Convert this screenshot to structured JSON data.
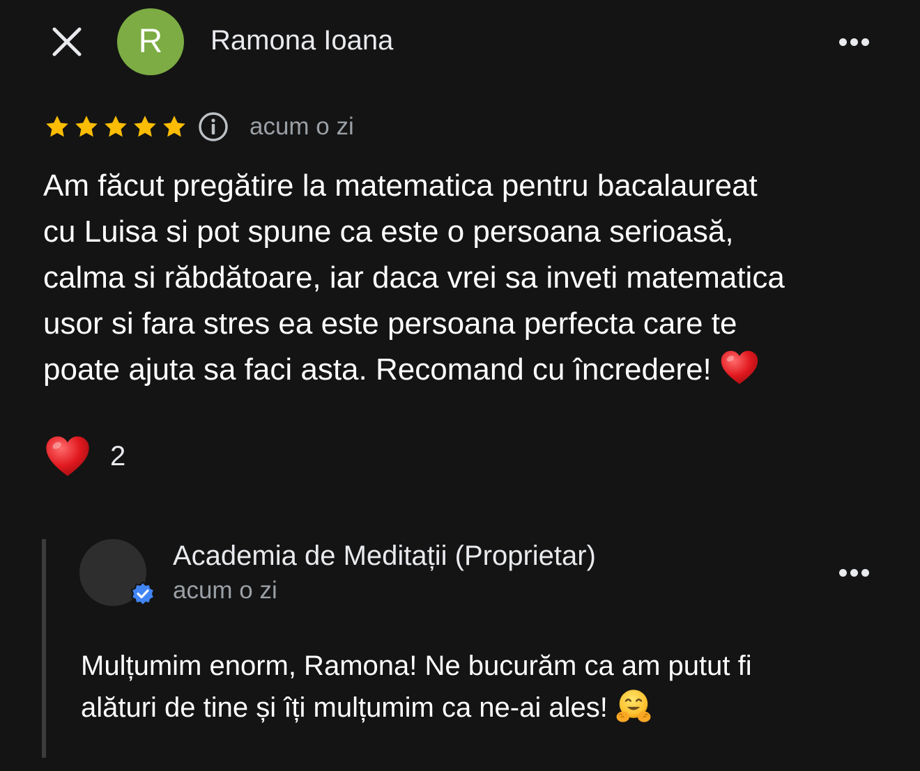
{
  "header": {
    "reviewer_initial": "R",
    "reviewer_name": "Ramona Ioana",
    "avatar_color": "#7cac43"
  },
  "review": {
    "rating": 5,
    "max_rating": 5,
    "star_color": "#fbbc04",
    "time": "acum o zi",
    "text_lines": [
      "Am făcut pregătire la matematica pentru bacalaureat",
      "cu Luisa si pot spune ca este o persoana serioasă,",
      "calma si răbdătoare, iar daca vrei sa inveti matematica",
      "usor si fara stres ea este persoana perfecta care te",
      "poate ajuta sa faci asta. Recomand cu încredere!"
    ],
    "trailing_emoji": "red-heart"
  },
  "reactions": {
    "emoji": "red-heart",
    "count": "2"
  },
  "owner_reply": {
    "name": "Academia de Meditații (Proprietar)",
    "time": "acum o zi",
    "verified": true,
    "badge_color": "#4285f4",
    "text_lines": [
      "Mulțumim enorm, Ramona! Ne bucurăm ca am putut fi",
      "alături de tine și îți mulțumim ca ne-ai ales!"
    ],
    "trailing_emoji": "hugging-face"
  },
  "icons": {
    "close": "close-icon",
    "more": "more-horizontal-icon",
    "info": "info-icon",
    "star": "star-icon",
    "heart": "heart-emoji",
    "verified": "verified-check-icon",
    "hug": "hugging-face-emoji"
  }
}
